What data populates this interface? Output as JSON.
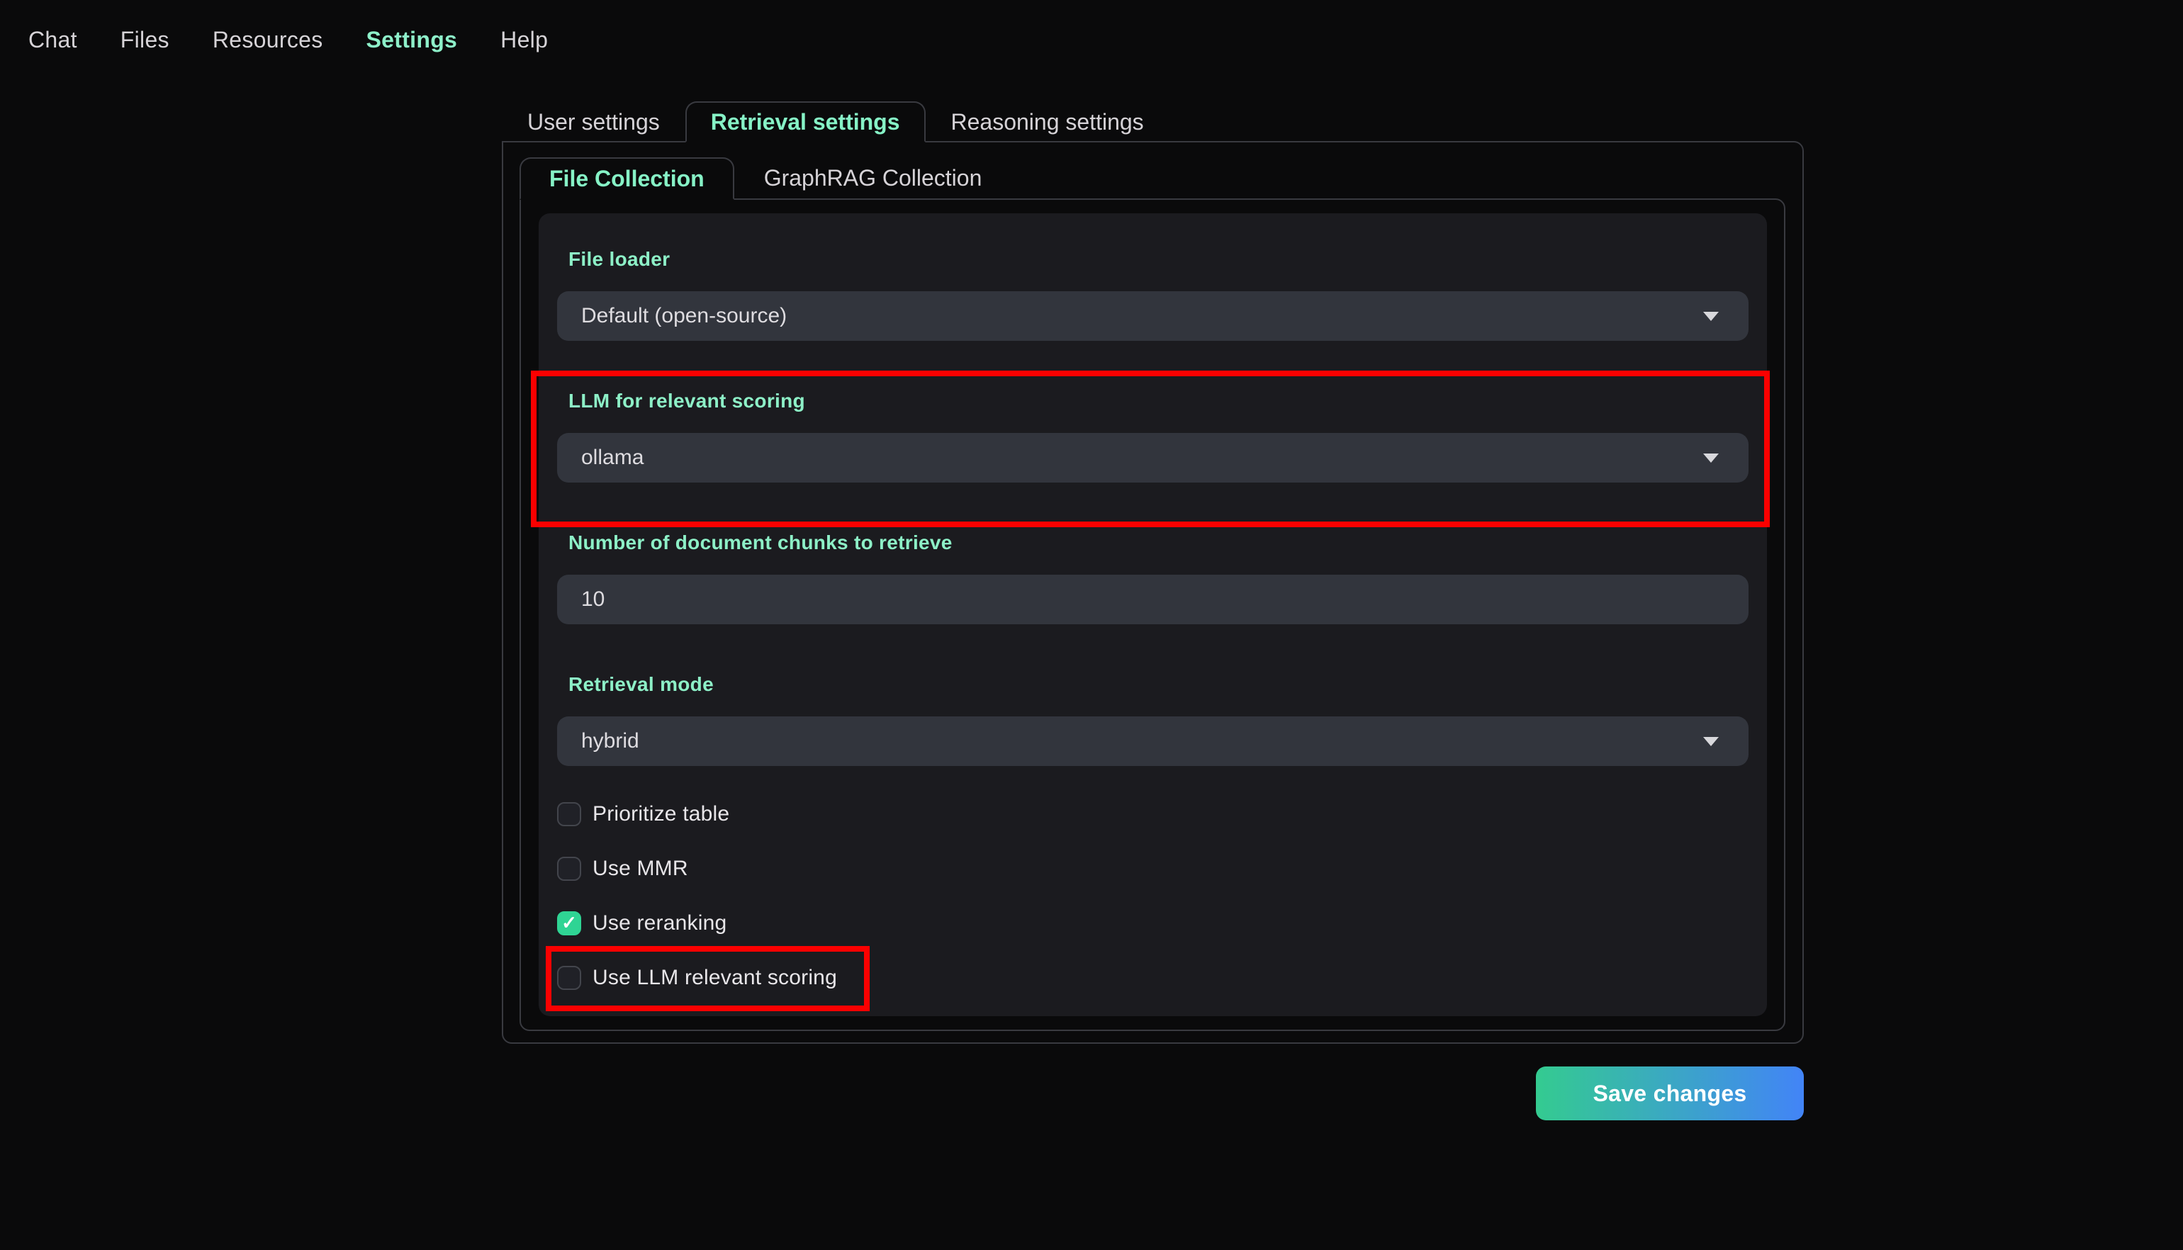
{
  "nav": {
    "items": [
      {
        "label": "Chat",
        "active": false
      },
      {
        "label": "Files",
        "active": false
      },
      {
        "label": "Resources",
        "active": false
      },
      {
        "label": "Settings",
        "active": true
      },
      {
        "label": "Help",
        "active": false
      }
    ]
  },
  "tabs": {
    "items": [
      {
        "label": "User settings",
        "active": false
      },
      {
        "label": "Retrieval settings",
        "active": true
      },
      {
        "label": "Reasoning settings",
        "active": false
      }
    ]
  },
  "subtabs": {
    "items": [
      {
        "label": "File Collection",
        "active": true
      },
      {
        "label": "GraphRAG Collection",
        "active": false
      }
    ]
  },
  "form": {
    "fields": [
      {
        "label": "File loader",
        "type": "select",
        "value": "Default (open-source)",
        "highlighted": false
      },
      {
        "label": "LLM for relevant scoring",
        "type": "select",
        "value": "ollama",
        "highlighted": true
      },
      {
        "label": "Number of document chunks to retrieve",
        "type": "input",
        "value": "10",
        "highlighted": false
      },
      {
        "label": "Retrieval mode",
        "type": "select",
        "value": "hybrid",
        "highlighted": false
      }
    ],
    "checkboxes": [
      {
        "label": "Prioritize table",
        "checked": false,
        "highlighted": false
      },
      {
        "label": "Use MMR",
        "checked": false,
        "highlighted": false
      },
      {
        "label": "Use reranking",
        "checked": true,
        "highlighted": false
      },
      {
        "label": "Use LLM relevant scoring",
        "checked": false,
        "highlighted": true
      }
    ]
  },
  "save_button": {
    "label": "Save changes"
  },
  "icons": {
    "check_glyph": "✓",
    "chevron_down": "▾"
  },
  "colors": {
    "accent_green": "#8df0c7",
    "tab_active_green": "#86f2c6",
    "checkbox_checked": "#2fd494",
    "highlight_red": "#fb0000",
    "save_gradient_start": "#34cb90",
    "save_gradient_end": "#4284f7",
    "card_background": "#1b1b1f",
    "control_background": "#32353d",
    "page_background": "#0a0a0b",
    "border": "#393a40"
  }
}
